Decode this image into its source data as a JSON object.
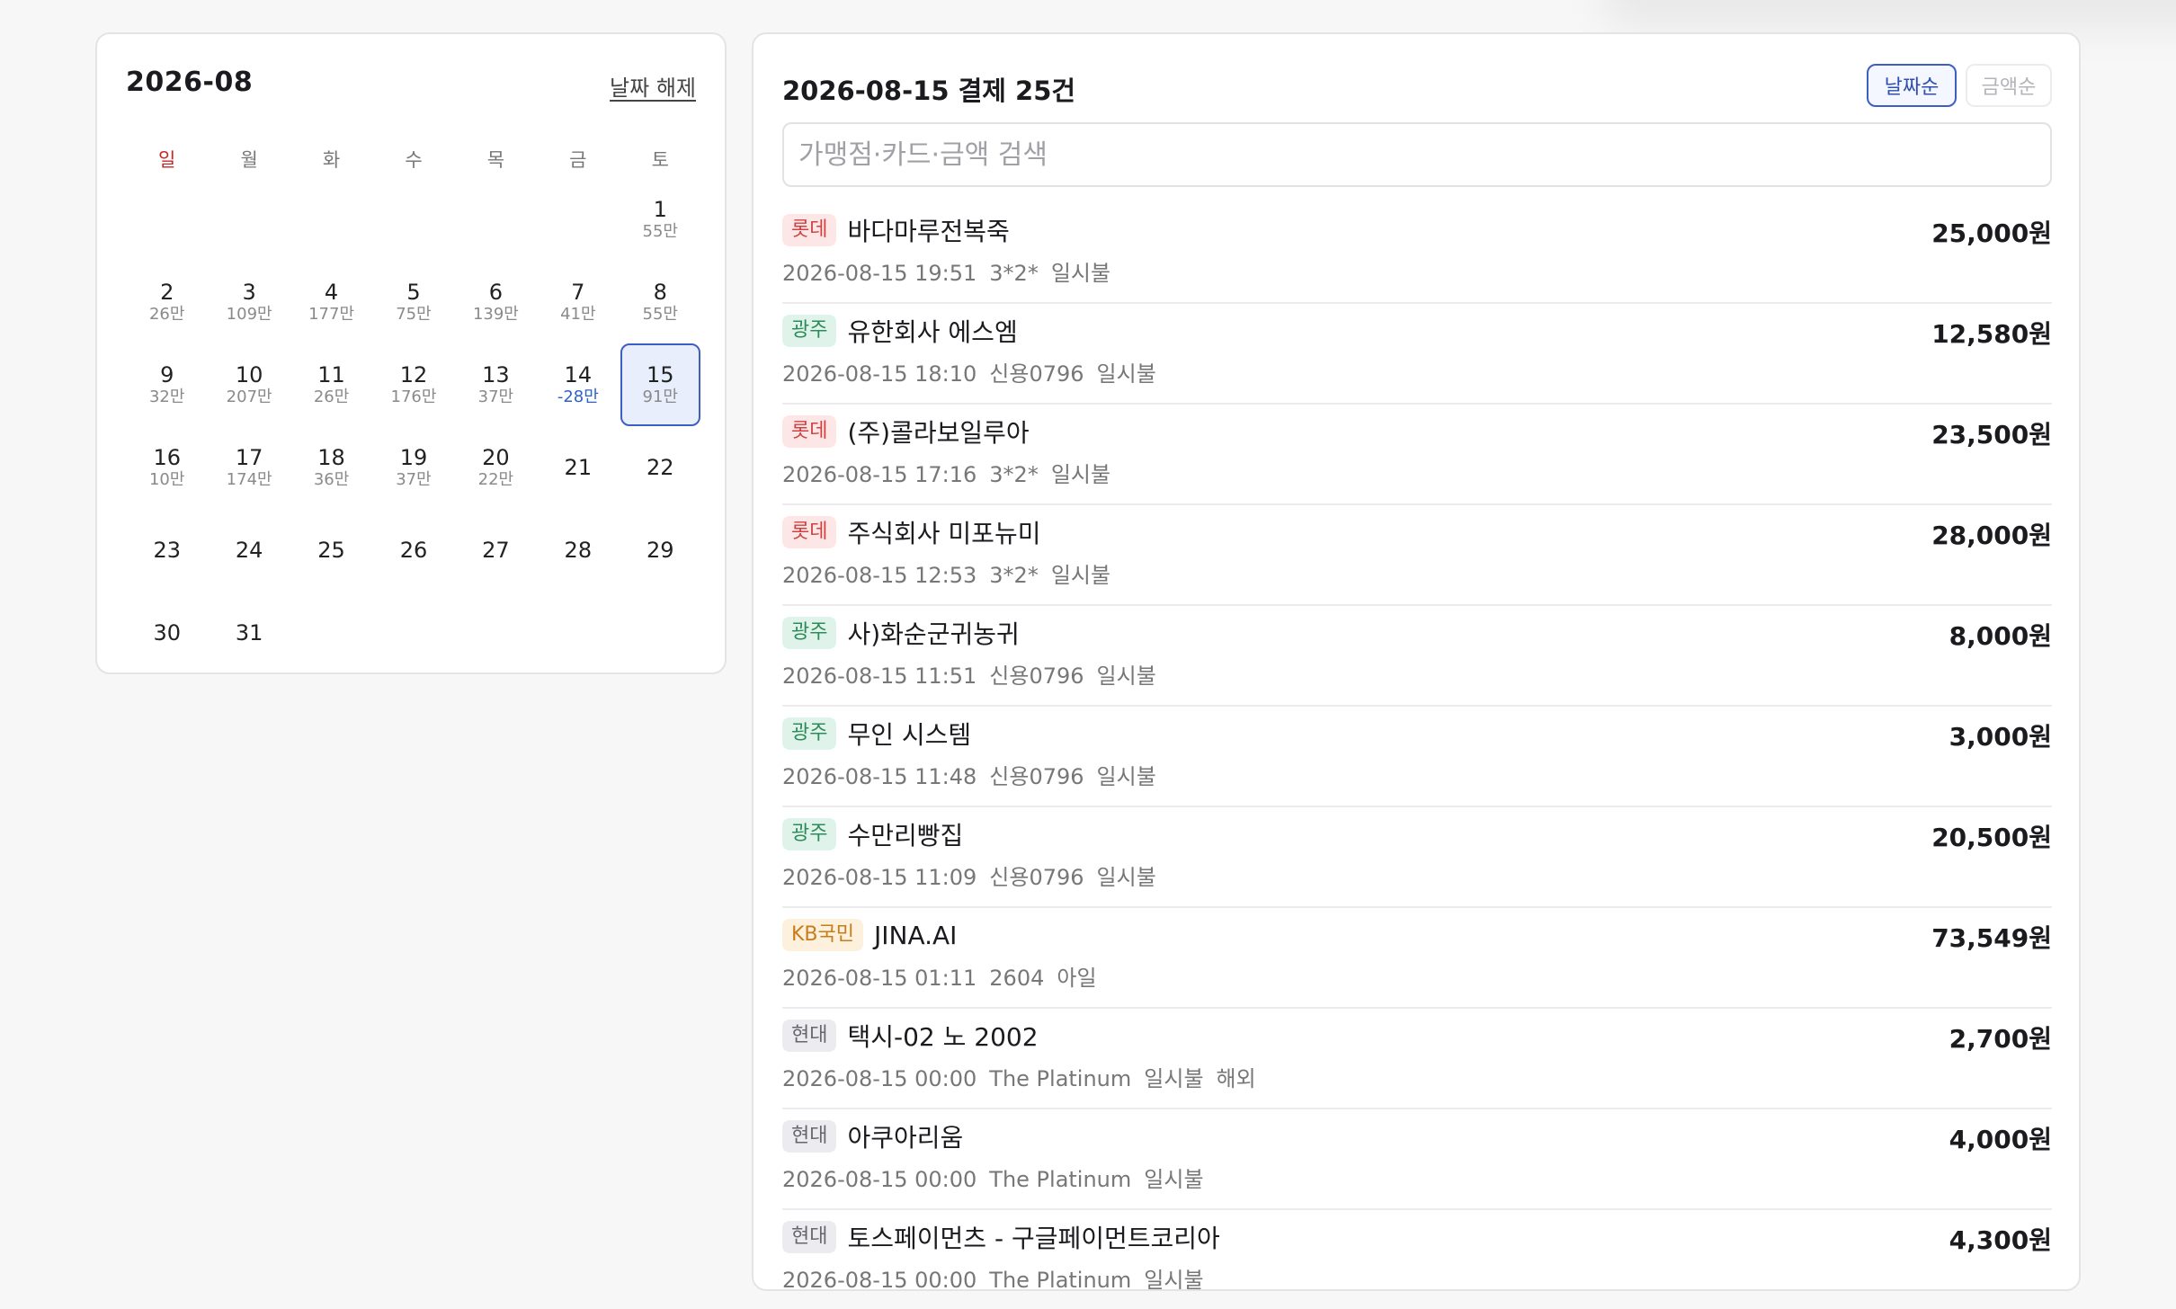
{
  "calendar": {
    "month": "2026-08",
    "clear_label": "날짜 해제",
    "weekdays": [
      "일",
      "월",
      "화",
      "수",
      "목",
      "금",
      "토"
    ],
    "days": [
      null,
      null,
      null,
      null,
      null,
      null,
      {
        "d": "1",
        "amt": "55만"
      },
      {
        "d": "2",
        "amt": "26만"
      },
      {
        "d": "3",
        "amt": "109만"
      },
      {
        "d": "4",
        "amt": "177만"
      },
      {
        "d": "5",
        "amt": "75만"
      },
      {
        "d": "6",
        "amt": "139만"
      },
      {
        "d": "7",
        "amt": "41만"
      },
      {
        "d": "8",
        "amt": "55만"
      },
      {
        "d": "9",
        "amt": "32만"
      },
      {
        "d": "10",
        "amt": "207만"
      },
      {
        "d": "11",
        "amt": "26만"
      },
      {
        "d": "12",
        "amt": "176만"
      },
      {
        "d": "13",
        "amt": "37만"
      },
      {
        "d": "14",
        "amt": "-28만",
        "neg": true
      },
      {
        "d": "15",
        "amt": "91만",
        "selected": true
      },
      {
        "d": "16",
        "amt": "10만"
      },
      {
        "d": "17",
        "amt": "174만"
      },
      {
        "d": "18",
        "amt": "36만"
      },
      {
        "d": "19",
        "amt": "37만"
      },
      {
        "d": "20",
        "amt": "22만"
      },
      {
        "d": "21",
        "amt": ""
      },
      {
        "d": "22",
        "amt": ""
      },
      {
        "d": "23",
        "amt": ""
      },
      {
        "d": "24",
        "amt": ""
      },
      {
        "d": "25",
        "amt": ""
      },
      {
        "d": "26",
        "amt": ""
      },
      {
        "d": "27",
        "amt": ""
      },
      {
        "d": "28",
        "amt": ""
      },
      {
        "d": "29",
        "amt": ""
      },
      {
        "d": "30",
        "amt": ""
      },
      {
        "d": "31",
        "amt": ""
      }
    ]
  },
  "transactions": {
    "title": "2026-08-15 결제 25건",
    "sort_date_label": "날짜순",
    "sort_amount_label": "금액순",
    "search_placeholder": "가맹점·카드·금액 검색",
    "badge_colors": {
      "lotte": "#d04141",
      "gwangju": "#2e8b57",
      "kb": "#c77d1a",
      "hyundai": "#666670"
    },
    "items": [
      {
        "card": "롯데",
        "kind": "lotte",
        "merchant": "바다마루전복죽",
        "datetime": "2026-08-15 19:51",
        "card_no": "3*2*",
        "install": "일시불",
        "extra": "",
        "amount": "25,000원"
      },
      {
        "card": "광주",
        "kind": "gwangju",
        "merchant": "유한회사 에스엠",
        "datetime": "2026-08-15 18:10",
        "card_no": "신용0796",
        "install": "일시불",
        "extra": "",
        "amount": "12,580원"
      },
      {
        "card": "롯데",
        "kind": "lotte",
        "merchant": "(주)콜라보일루아",
        "datetime": "2026-08-15 17:16",
        "card_no": "3*2*",
        "install": "일시불",
        "extra": "",
        "amount": "23,500원"
      },
      {
        "card": "롯데",
        "kind": "lotte",
        "merchant": "주식회사 미포뉴미",
        "datetime": "2026-08-15 12:53",
        "card_no": "3*2*",
        "install": "일시불",
        "extra": "",
        "amount": "28,000원"
      },
      {
        "card": "광주",
        "kind": "gwangju",
        "merchant": "사)화순군귀농귀",
        "datetime": "2026-08-15 11:51",
        "card_no": "신용0796",
        "install": "일시불",
        "extra": "",
        "amount": "8,000원"
      },
      {
        "card": "광주",
        "kind": "gwangju",
        "merchant": "무인 시스템",
        "datetime": "2026-08-15 11:48",
        "card_no": "신용0796",
        "install": "일시불",
        "extra": "",
        "amount": "3,000원"
      },
      {
        "card": "광주",
        "kind": "gwangju",
        "merchant": "수만리빵집",
        "datetime": "2026-08-15 11:09",
        "card_no": "신용0796",
        "install": "일시불",
        "extra": "",
        "amount": "20,500원"
      },
      {
        "card": "KB국민",
        "kind": "kb",
        "merchant": "JINA.AI",
        "datetime": "2026-08-15 01:11",
        "card_no": "2604",
        "install": "아일",
        "extra": "",
        "amount": "73,549원"
      },
      {
        "card": "현대",
        "kind": "hyundai",
        "merchant": "택시-02 노 2002",
        "datetime": "2026-08-15 00:00",
        "card_no": "The Platinum",
        "install": "일시불",
        "extra": "해외",
        "amount": "2,700원"
      },
      {
        "card": "현대",
        "kind": "hyundai",
        "merchant": "아쿠아리움",
        "datetime": "2026-08-15 00:00",
        "card_no": "The Platinum",
        "install": "일시불",
        "extra": "",
        "amount": "4,000원"
      },
      {
        "card": "현대",
        "kind": "hyundai",
        "merchant": "토스페이먼츠 - 구글페이먼트코리아",
        "datetime": "2026-08-15 00:00",
        "card_no": "The Platinum",
        "install": "일시불",
        "extra": "",
        "amount": "4,300원"
      }
    ]
  }
}
